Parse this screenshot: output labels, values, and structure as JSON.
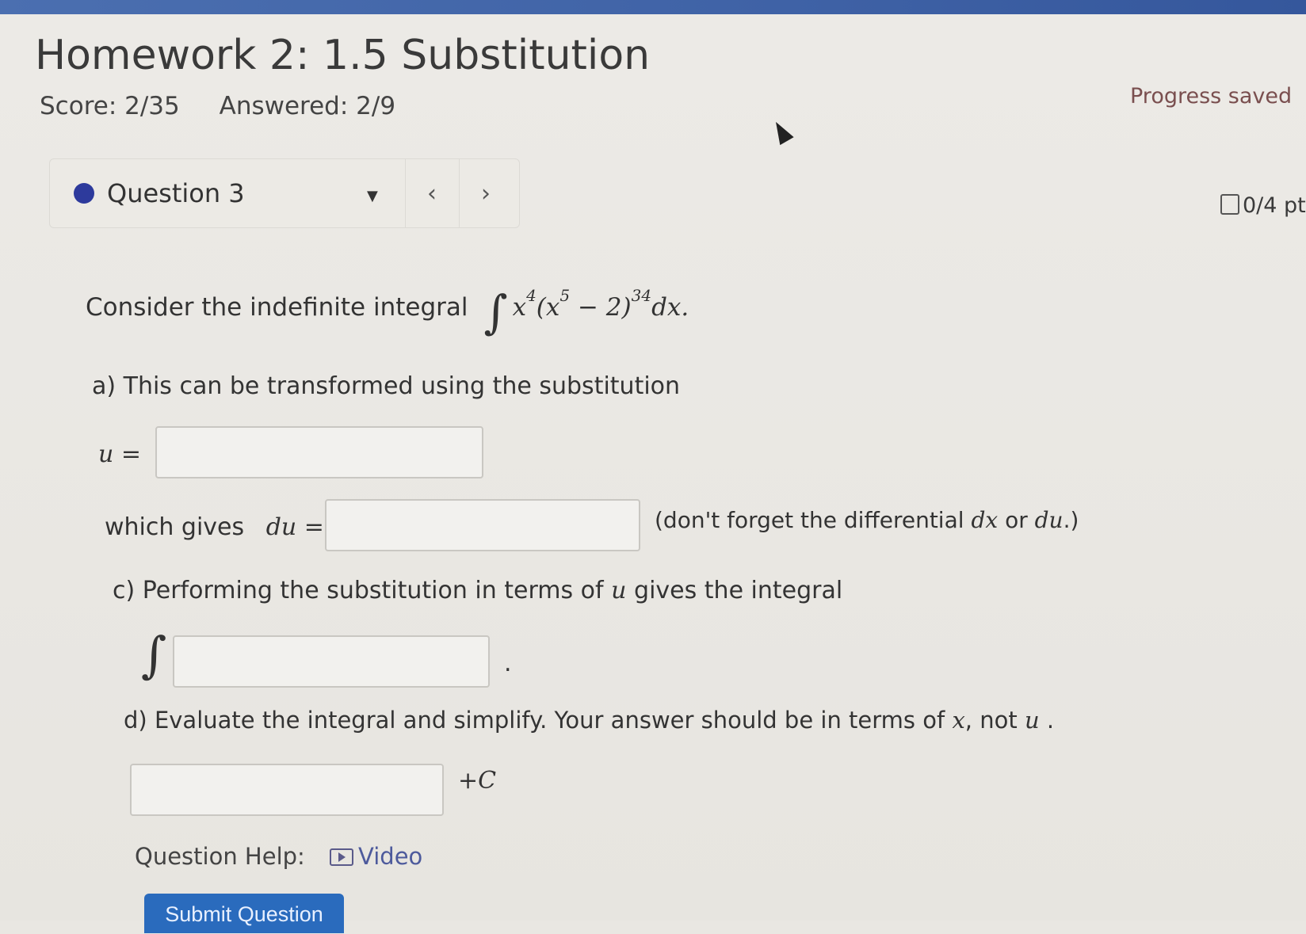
{
  "header": {
    "title": "Homework 2: 1.5 Substitution",
    "score": "Score: 2/35",
    "answered": "Answered: 2/9",
    "progress_status": "Progress saved"
  },
  "question_nav": {
    "question_label": "Question 3",
    "prev_symbol": "‹",
    "next_symbol": "›",
    "points": "0/4 pt"
  },
  "question": {
    "prompt_text": "Consider the indefinite integral",
    "integral": {
      "integral_sign": "∫",
      "base": "x",
      "base_exp": "4",
      "inner_open": "(x",
      "inner_exp": "5",
      "inner_rest": " − 2)",
      "outer_exp": "34",
      "differential": "dx."
    },
    "part_a": "a) This can be transformed using the substitution",
    "u_label": "u =",
    "which_gives": "which gives",
    "du_label": "du =",
    "reminder_prefix": "(don't forget the differential",
    "reminder_dx": "dx",
    "reminder_or": "or",
    "reminder_du": "du",
    "reminder_suffix": ".)",
    "part_c_prefix": "c)  Performing the substitution in terms of",
    "part_c_var": "u",
    "part_c_suffix": "gives the integral",
    "part_c_integral": "∫",
    "part_c_period": ".",
    "part_d_prefix": "d) Evaluate the integral and simplify. Your answer should be in terms of",
    "part_d_x": "x",
    "part_d_mid": ", not",
    "part_d_u": "u",
    "part_d_end": ".",
    "plus_c": "+C"
  },
  "help": {
    "label": "Question Help:",
    "video": "Video"
  },
  "submit": {
    "label": "Submit Question"
  }
}
